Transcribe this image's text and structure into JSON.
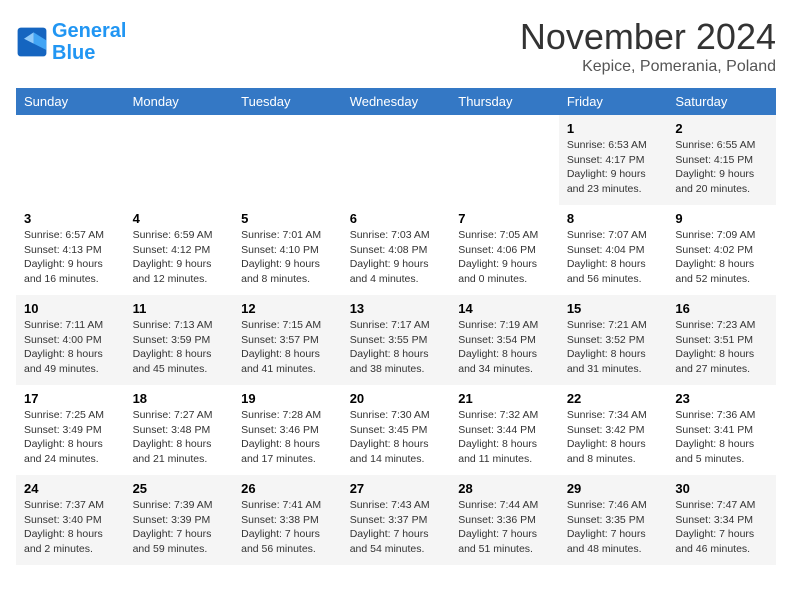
{
  "header": {
    "logo_line1": "General",
    "logo_line2": "Blue",
    "month": "November 2024",
    "location": "Kepice, Pomerania, Poland"
  },
  "weekdays": [
    "Sunday",
    "Monday",
    "Tuesday",
    "Wednesday",
    "Thursday",
    "Friday",
    "Saturday"
  ],
  "weeks": [
    [
      {
        "day": "",
        "info": ""
      },
      {
        "day": "",
        "info": ""
      },
      {
        "day": "",
        "info": ""
      },
      {
        "day": "",
        "info": ""
      },
      {
        "day": "",
        "info": ""
      },
      {
        "day": "1",
        "info": "Sunrise: 6:53 AM\nSunset: 4:17 PM\nDaylight: 9 hours and 23 minutes."
      },
      {
        "day": "2",
        "info": "Sunrise: 6:55 AM\nSunset: 4:15 PM\nDaylight: 9 hours and 20 minutes."
      }
    ],
    [
      {
        "day": "3",
        "info": "Sunrise: 6:57 AM\nSunset: 4:13 PM\nDaylight: 9 hours and 16 minutes."
      },
      {
        "day": "4",
        "info": "Sunrise: 6:59 AM\nSunset: 4:12 PM\nDaylight: 9 hours and 12 minutes."
      },
      {
        "day": "5",
        "info": "Sunrise: 7:01 AM\nSunset: 4:10 PM\nDaylight: 9 hours and 8 minutes."
      },
      {
        "day": "6",
        "info": "Sunrise: 7:03 AM\nSunset: 4:08 PM\nDaylight: 9 hours and 4 minutes."
      },
      {
        "day": "7",
        "info": "Sunrise: 7:05 AM\nSunset: 4:06 PM\nDaylight: 9 hours and 0 minutes."
      },
      {
        "day": "8",
        "info": "Sunrise: 7:07 AM\nSunset: 4:04 PM\nDaylight: 8 hours and 56 minutes."
      },
      {
        "day": "9",
        "info": "Sunrise: 7:09 AM\nSunset: 4:02 PM\nDaylight: 8 hours and 52 minutes."
      }
    ],
    [
      {
        "day": "10",
        "info": "Sunrise: 7:11 AM\nSunset: 4:00 PM\nDaylight: 8 hours and 49 minutes."
      },
      {
        "day": "11",
        "info": "Sunrise: 7:13 AM\nSunset: 3:59 PM\nDaylight: 8 hours and 45 minutes."
      },
      {
        "day": "12",
        "info": "Sunrise: 7:15 AM\nSunset: 3:57 PM\nDaylight: 8 hours and 41 minutes."
      },
      {
        "day": "13",
        "info": "Sunrise: 7:17 AM\nSunset: 3:55 PM\nDaylight: 8 hours and 38 minutes."
      },
      {
        "day": "14",
        "info": "Sunrise: 7:19 AM\nSunset: 3:54 PM\nDaylight: 8 hours and 34 minutes."
      },
      {
        "day": "15",
        "info": "Sunrise: 7:21 AM\nSunset: 3:52 PM\nDaylight: 8 hours and 31 minutes."
      },
      {
        "day": "16",
        "info": "Sunrise: 7:23 AM\nSunset: 3:51 PM\nDaylight: 8 hours and 27 minutes."
      }
    ],
    [
      {
        "day": "17",
        "info": "Sunrise: 7:25 AM\nSunset: 3:49 PM\nDaylight: 8 hours and 24 minutes."
      },
      {
        "day": "18",
        "info": "Sunrise: 7:27 AM\nSunset: 3:48 PM\nDaylight: 8 hours and 21 minutes."
      },
      {
        "day": "19",
        "info": "Sunrise: 7:28 AM\nSunset: 3:46 PM\nDaylight: 8 hours and 17 minutes."
      },
      {
        "day": "20",
        "info": "Sunrise: 7:30 AM\nSunset: 3:45 PM\nDaylight: 8 hours and 14 minutes."
      },
      {
        "day": "21",
        "info": "Sunrise: 7:32 AM\nSunset: 3:44 PM\nDaylight: 8 hours and 11 minutes."
      },
      {
        "day": "22",
        "info": "Sunrise: 7:34 AM\nSunset: 3:42 PM\nDaylight: 8 hours and 8 minutes."
      },
      {
        "day": "23",
        "info": "Sunrise: 7:36 AM\nSunset: 3:41 PM\nDaylight: 8 hours and 5 minutes."
      }
    ],
    [
      {
        "day": "24",
        "info": "Sunrise: 7:37 AM\nSunset: 3:40 PM\nDaylight: 8 hours and 2 minutes."
      },
      {
        "day": "25",
        "info": "Sunrise: 7:39 AM\nSunset: 3:39 PM\nDaylight: 7 hours and 59 minutes."
      },
      {
        "day": "26",
        "info": "Sunrise: 7:41 AM\nSunset: 3:38 PM\nDaylight: 7 hours and 56 minutes."
      },
      {
        "day": "27",
        "info": "Sunrise: 7:43 AM\nSunset: 3:37 PM\nDaylight: 7 hours and 54 minutes."
      },
      {
        "day": "28",
        "info": "Sunrise: 7:44 AM\nSunset: 3:36 PM\nDaylight: 7 hours and 51 minutes."
      },
      {
        "day": "29",
        "info": "Sunrise: 7:46 AM\nSunset: 3:35 PM\nDaylight: 7 hours and 48 minutes."
      },
      {
        "day": "30",
        "info": "Sunrise: 7:47 AM\nSunset: 3:34 PM\nDaylight: 7 hours and 46 minutes."
      }
    ]
  ]
}
